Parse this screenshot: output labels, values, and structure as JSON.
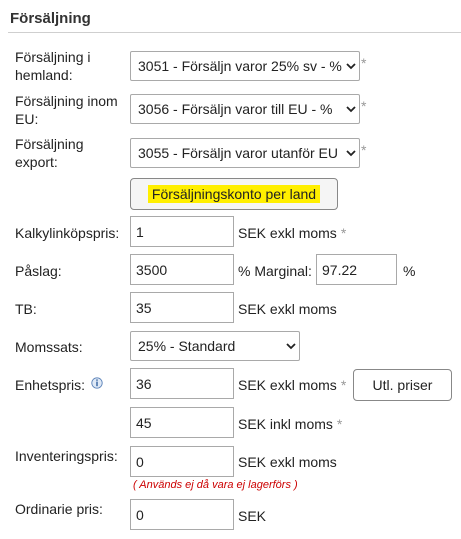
{
  "section": {
    "title": "Försäljning"
  },
  "accounts": {
    "domestic": {
      "label_line1": "Försäljning i",
      "label_line2": "hemland:",
      "value": "3051 - Försäljn varor 25% sv - %"
    },
    "eu": {
      "label_line1": "Försäljning inom",
      "label_line2": "EU:",
      "value": "3056 - Försäljn varor till EU - %"
    },
    "export": {
      "label_line1": "Försäljning",
      "label_line2": "export:",
      "value": "3055 - Försäljn varor utanför EU"
    },
    "required_mark": "*",
    "country_button_label": "Försäljningskonto per land"
  },
  "pricing": {
    "cost": {
      "label": "Kalkylinköpspris:",
      "value": "1",
      "unit": "SEK exkl moms"
    },
    "markup": {
      "label": "Påslag:",
      "value": "3500",
      "unit": "% Marginal:",
      "margin_value": "97.22",
      "margin_unit": "%"
    },
    "gross_profit": {
      "label": "TB:",
      "value": "35",
      "unit": "SEK exkl moms"
    },
    "vat": {
      "label": "Momssats:",
      "value": "25% - Standard"
    },
    "unit_price": {
      "label": "Enhetspris:",
      "value_excl": "36",
      "unit_excl": "SEK exkl moms",
      "value_incl": "45",
      "unit_incl": "SEK inkl moms",
      "button_label": "Utl. priser"
    },
    "inventory": {
      "label": "Inventeringspris:",
      "value": "0",
      "unit": "SEK exkl moms",
      "note": "( Används ej då vara ej lagerförs )"
    },
    "regular": {
      "label": "Ordinarie pris:",
      "value": "0",
      "unit": "SEK"
    }
  }
}
